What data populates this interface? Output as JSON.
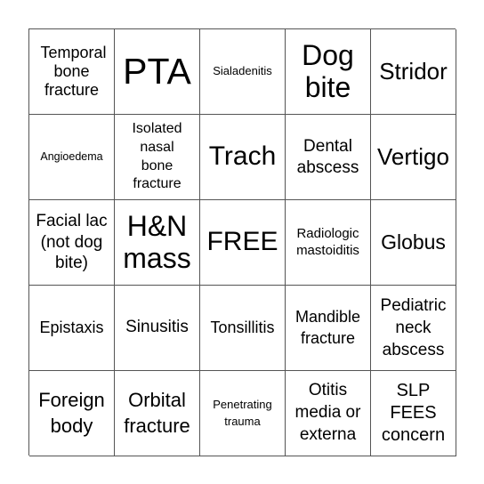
{
  "board": {
    "colors": {
      "grid_line": "#555555",
      "text": "#000000",
      "background": "#ffffff"
    },
    "cells": [
      {
        "label": "Temporal bone fracture"
      },
      {
        "label": "PTA"
      },
      {
        "label": "Sialadenitis"
      },
      {
        "label": "Dog bite"
      },
      {
        "label": "Stridor"
      },
      {
        "label": "Angioedema"
      },
      {
        "label": "Isolated nasal bone fracture"
      },
      {
        "label": "Trach"
      },
      {
        "label": "Dental abscess"
      },
      {
        "label": "Vertigo"
      },
      {
        "label": "Facial lac (not dog bite)"
      },
      {
        "label": "H&N mass"
      },
      {
        "label": "FREE"
      },
      {
        "label": "Radiologic mastoiditis"
      },
      {
        "label": "Globus"
      },
      {
        "label": "Epistaxis"
      },
      {
        "label": "Sinusitis"
      },
      {
        "label": "Tonsillitis"
      },
      {
        "label": "Mandible fracture"
      },
      {
        "label": "Pediatric neck abscess"
      },
      {
        "label": "Foreign body"
      },
      {
        "label": "Orbital fracture"
      },
      {
        "label": "Penetrating trauma"
      },
      {
        "label": "Otitis media or externa"
      },
      {
        "label": "SLP FEES concern"
      }
    ]
  }
}
